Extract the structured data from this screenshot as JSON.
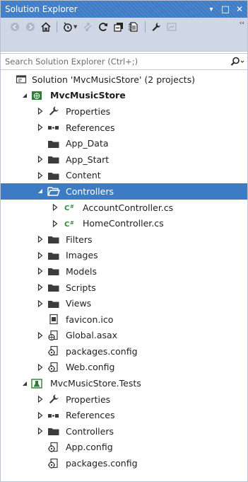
{
  "window": {
    "title": "Solution Explorer",
    "pin_glyph": "▾",
    "maximize_glyph": "□",
    "close_glyph": "✕"
  },
  "toolbar": {
    "icons": [
      "back-icon",
      "forward-icon",
      "home-icon",
      "history-icon",
      "sync-icon",
      "refresh-icon",
      "collapse-all-icon",
      "show-all-files-icon",
      "properties-icon",
      "preview-icon"
    ],
    "overflow_glyph": "‹‹"
  },
  "search": {
    "placeholder": "Search Solution Explorer (Ctrl+;)",
    "value": ""
  },
  "colors": {
    "titlebar": "#3d7bc4",
    "toolbar": "#cfd6e5",
    "selection": "#3d7bc4",
    "folder": "#3c3c3c",
    "csharp": "#2e8b3a"
  },
  "tree": [
    {
      "label": "Solution 'MvcMusicStore' (2 projects)",
      "level": 0,
      "expander": "none",
      "icon": "solution-icon",
      "bold": false
    },
    {
      "label": "MvcMusicStore",
      "level": 1,
      "expander": "expanded",
      "icon": "web-project-icon",
      "bold": true
    },
    {
      "label": "Properties",
      "level": 2,
      "expander": "collapsed",
      "icon": "wrench-icon"
    },
    {
      "label": "References",
      "level": 2,
      "expander": "collapsed",
      "icon": "references-icon"
    },
    {
      "label": "App_Data",
      "level": 2,
      "expander": "none",
      "icon": "folder-icon"
    },
    {
      "label": "App_Start",
      "level": 2,
      "expander": "collapsed",
      "icon": "folder-icon"
    },
    {
      "label": "Content",
      "level": 2,
      "expander": "collapsed",
      "icon": "folder-icon"
    },
    {
      "label": "Controllers",
      "level": 2,
      "expander": "expanded",
      "icon": "folder-open-icon",
      "selected": true
    },
    {
      "label": "AccountController.cs",
      "level": 3,
      "expander": "collapsed",
      "icon": "csharp-file-icon"
    },
    {
      "label": "HomeController.cs",
      "level": 3,
      "expander": "collapsed",
      "icon": "csharp-file-icon"
    },
    {
      "label": "Filters",
      "level": 2,
      "expander": "collapsed",
      "icon": "folder-icon"
    },
    {
      "label": "Images",
      "level": 2,
      "expander": "collapsed",
      "icon": "folder-icon"
    },
    {
      "label": "Models",
      "level": 2,
      "expander": "collapsed",
      "icon": "folder-icon"
    },
    {
      "label": "Scripts",
      "level": 2,
      "expander": "collapsed",
      "icon": "folder-icon"
    },
    {
      "label": "Views",
      "level": 2,
      "expander": "collapsed",
      "icon": "folder-icon"
    },
    {
      "label": "favicon.ico",
      "level": 2,
      "expander": "none",
      "icon": "image-file-icon"
    },
    {
      "label": "Global.asax",
      "level": 2,
      "expander": "collapsed",
      "icon": "global-asax-icon"
    },
    {
      "label": "packages.config",
      "level": 2,
      "expander": "none",
      "icon": "config-file-icon"
    },
    {
      "label": "Web.config",
      "level": 2,
      "expander": "collapsed",
      "icon": "config-file-icon"
    },
    {
      "label": "MvcMusicStore.Tests",
      "level": 1,
      "expander": "expanded",
      "icon": "test-project-icon"
    },
    {
      "label": "Properties",
      "level": 2,
      "expander": "collapsed",
      "icon": "wrench-icon"
    },
    {
      "label": "References",
      "level": 2,
      "expander": "collapsed",
      "icon": "references-icon"
    },
    {
      "label": "Controllers",
      "level": 2,
      "expander": "collapsed",
      "icon": "folder-icon"
    },
    {
      "label": "App.config",
      "level": 2,
      "expander": "none",
      "icon": "config-file-icon"
    },
    {
      "label": "packages.config",
      "level": 2,
      "expander": "none",
      "icon": "config-file-icon"
    }
  ]
}
